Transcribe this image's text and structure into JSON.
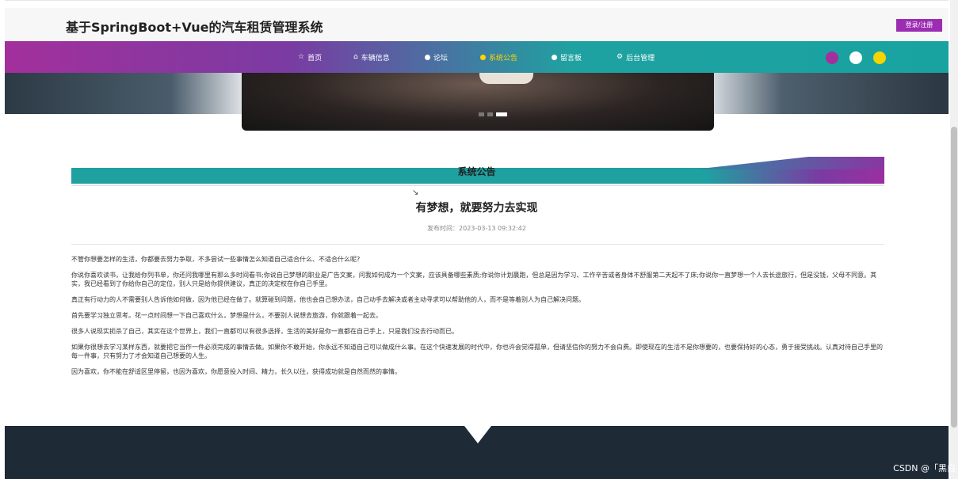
{
  "header": {
    "site_title": "基于SpringBoot+Vue的汽车租赁管理系统",
    "login_button": "登录/注册"
  },
  "nav": {
    "items": [
      {
        "label": "首页",
        "icon": "star-icon"
      },
      {
        "label": "车辆信息",
        "icon": "car-icon"
      },
      {
        "label": "论坛",
        "icon": "dot-icon"
      },
      {
        "label": "系统公告",
        "icon": "dot-icon",
        "active": true
      },
      {
        "label": "留言板",
        "icon": "dot-icon"
      },
      {
        "label": "后台管理",
        "icon": "gear-icon"
      }
    ],
    "theme_dots": [
      "#a3309c",
      "#ffffff",
      "#f5d400"
    ],
    "gradient": [
      "#a3309c",
      "#1fa1a1"
    ]
  },
  "section": {
    "title": "系统公告"
  },
  "article": {
    "title": "有梦想，就要努力去实现",
    "publish_label": "发布时间",
    "publish_time": "2023-03-13 09:32:42",
    "paragraphs": [
      "不管你想要怎样的生活，你都要去努力争取，不多尝试一些事情怎么知道自己适合什么、不适合什么呢?",
      "你说你喜欢读书，让我给你列书单，你还问我哪里有那么多时间看书;你说自己梦想的职业是广告文案，问我如何成为一个文案，应该具备哪些素质;你说你计划晨跑，但总是因为学习、工作辛苦或者身体不舒服第二天起不了床;你说你一直梦想一个人去长途旅行，但是没钱，父母不同意。其实，我已经看到了你给你自己的定位，别人只是给你提供建议，真正的决定权在你自己手里。",
      "真正有行动力的人不需要别人告诉他如何做，因为他已经在做了。就算碰到问题，他也会自己想办法，自己动手去解决或者主动寻求可以帮助他的人，而不是等着别人为自己解决问题。",
      "首先要学习独立思考。花一点时间想一下自己喜欢什么，梦想是什么，不要别人说想去旅游，你就跟着一起去。",
      "很多人说现实扼杀了自己，其实在这个世界上，我们一直都可以有很多选择，生活的美好是你一直都在自己手上，只是我们没去行动而已。",
      "如果你很想去学习某样东西，就要把它当作一件必须完成的事情去做。如果你不敢开始，你永远不知道自己可以做成什么事。在这个快速发展的时代中，你也许会觉得孤单，但请坚信你的努力不会白费。即使现在的生活不是你想要的，也要保持好的心态，勇于接受挑战。认真对待自己手里的每一件事，只有努力了才会知道自己想要的人生。",
      "因为喜欢，你不能在舒适区里停留，也因为喜欢，你愿意投入时间、精力，长久以往，获得成功就是自然而然的事情。"
    ]
  },
  "watermark": "CSDN @「黑白"
}
